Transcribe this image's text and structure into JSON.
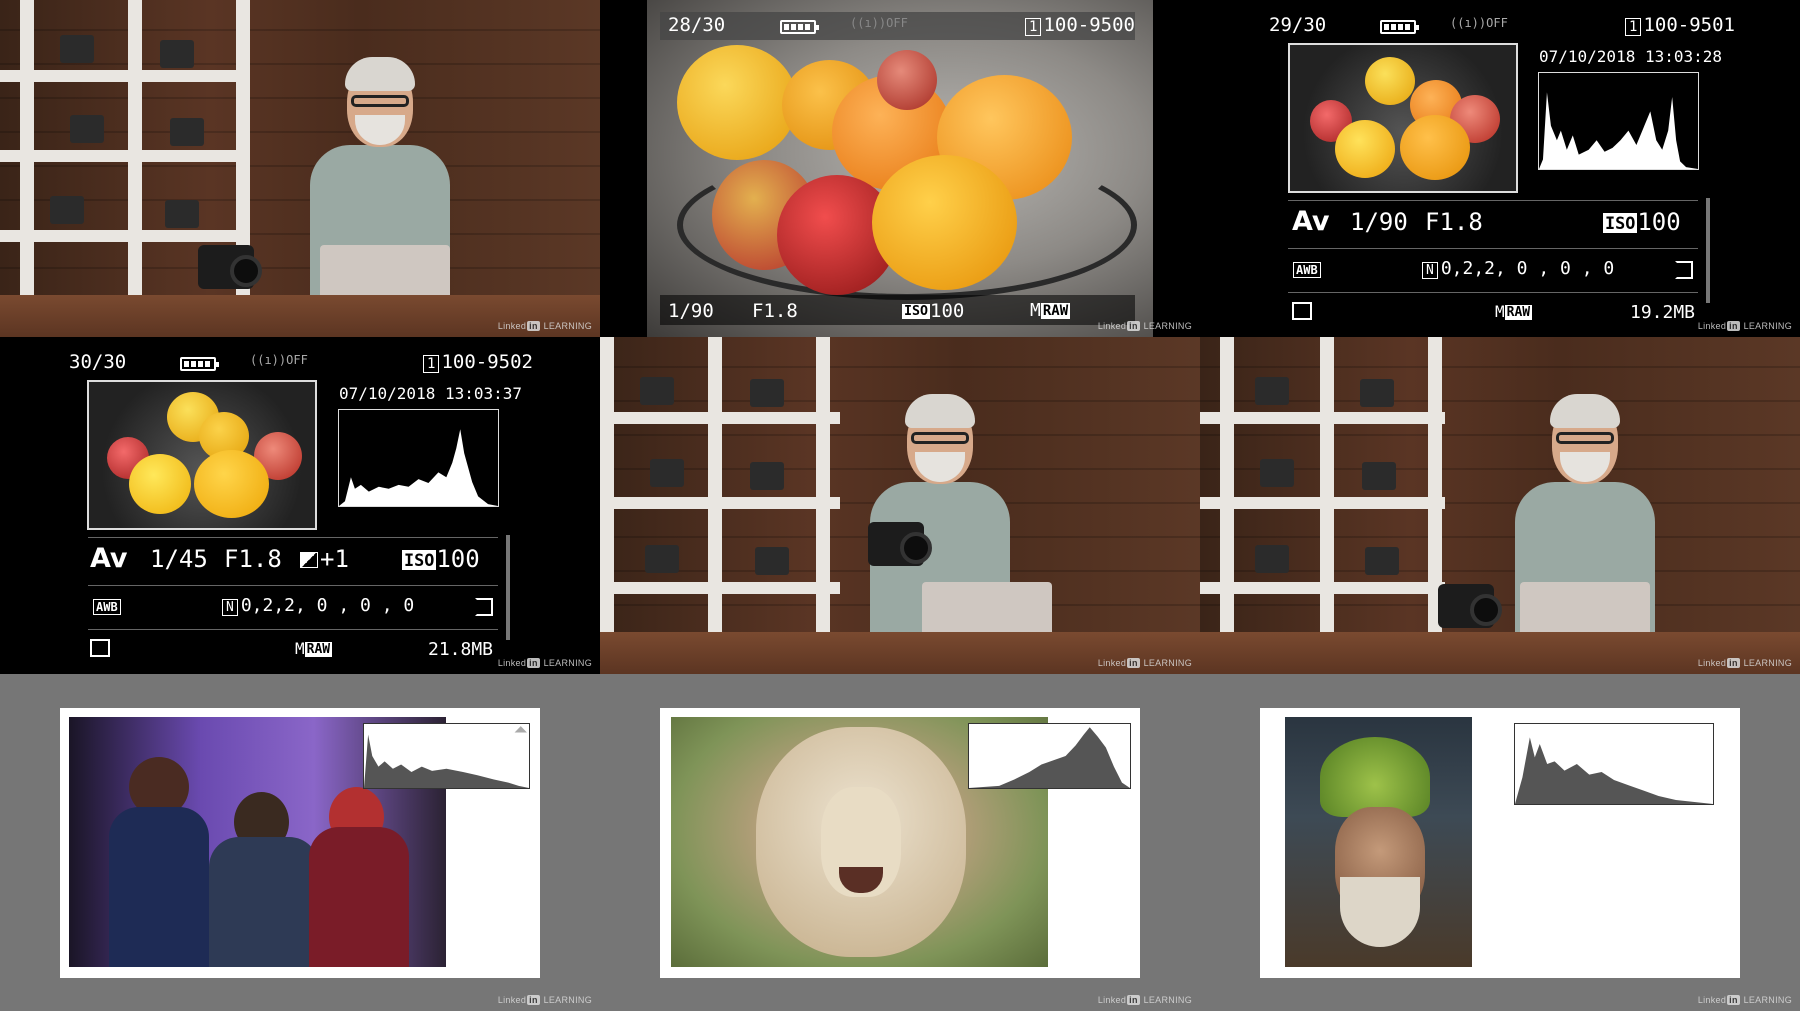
{
  "watermark": {
    "brand": "Linked",
    "badge": "in",
    "suffix": "LEARNING"
  },
  "frame_top_center": {
    "counter": "28/30",
    "wifi": "((ı))OFF",
    "folder_icon": "1",
    "file": "100-9500",
    "shutter": "1/90",
    "aperture": "F1.8",
    "iso_badge": "ISO",
    "iso": "100",
    "quality_prefix": "M",
    "quality": "RAW"
  },
  "frame_top_right": {
    "counter": "29/30",
    "wifi": "((ı))OFF",
    "folder_icon": "1",
    "file": "100-9501",
    "datetime": "07/10/2018 13:03:28",
    "mode": "Av",
    "shutter": "1/90",
    "aperture": "F1.8",
    "iso_badge": "ISO",
    "iso": "100",
    "wb": "AWB",
    "picture_style_icon": "N",
    "picture_style": "0,2,2, 0 , 0 , 0",
    "quality_prefix": "M",
    "quality": "RAW",
    "filesize": "19.2MB"
  },
  "frame_mid_left": {
    "counter": "30/30",
    "wifi": "((ı))OFF",
    "folder_icon": "1",
    "file": "100-9502",
    "datetime": "07/10/2018 13:03:37",
    "mode": "Av",
    "shutter": "1/45",
    "aperture": "F1.8",
    "exposure_comp": "+1",
    "iso_badge": "ISO",
    "iso": "100",
    "wb": "AWB",
    "picture_style_icon": "N",
    "picture_style": "0,2,2, 0 , 0 , 0",
    "quality_prefix": "M",
    "quality": "RAW",
    "filesize": "21.8MB"
  },
  "colors": {
    "slide_bg": "#767676",
    "hist_fill": "#555555",
    "lcd_bg": "#000000"
  }
}
